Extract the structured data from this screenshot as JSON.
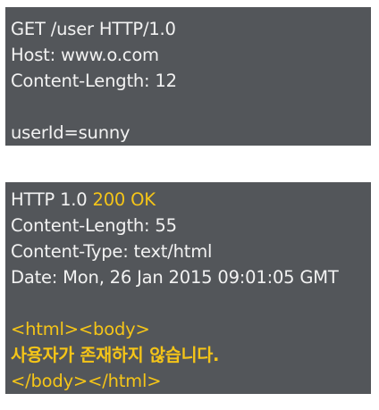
{
  "request": {
    "lines": [
      "GET /user HTTP/1.0",
      "Host: www.o.com",
      "Content-Length: 12"
    ],
    "body": "userId=sunny"
  },
  "response": {
    "status_prefix": "HTTP 1.0 ",
    "status_code": "200 OK",
    "headers": [
      "Content-Length: 55",
      "Content-Type: text/html",
      "Date: Mon, 26 Jan 2015 09:01:05 GMT"
    ],
    "body_lines": [
      "<html><body>",
      "사용자가 존재하지 않습니다.",
      "</body></html>"
    ]
  },
  "colors": {
    "panel_bg": "#53565a",
    "text": "#f2f2f2",
    "highlight": "#f5c518"
  }
}
